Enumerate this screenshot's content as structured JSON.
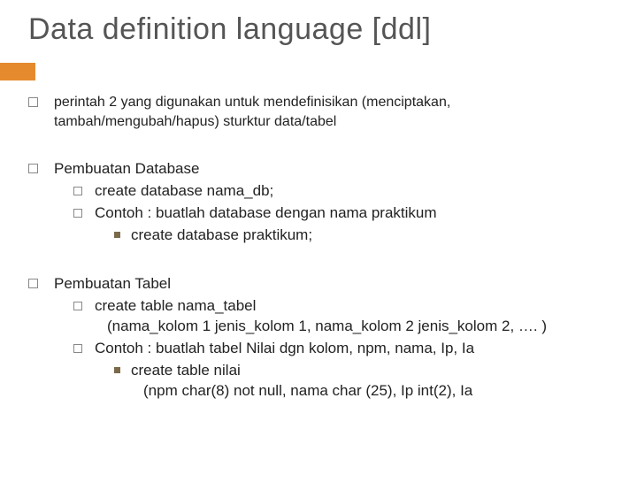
{
  "title": "Data definition language [ddl]",
  "items": [
    {
      "text": "perintah 2 yang digunakan untuk mendefinisikan (menciptakan, tambah/mengubah/hapus) sturktur data/tabel"
    },
    {
      "text": "Pembuatan Database",
      "children": [
        {
          "text": "create database nama_db;"
        },
        {
          "text": "Contoh : buatlah database dengan nama praktikum",
          "children": [
            {
              "text": "create database praktikum;"
            }
          ]
        }
      ]
    },
    {
      "text": "Pembuatan Tabel",
      "children": [
        {
          "text": "create table nama_tabel",
          "cont": "(nama_kolom 1 jenis_kolom 1, nama_kolom 2 jenis_kolom 2, …. )"
        },
        {
          "text": "Contoh : buatlah tabel Nilai dgn kolom, npm, nama, Ip, Ia",
          "children": [
            {
              "text": "create table nilai",
              "cont": "(npm char(8) not null, nama char (25), Ip int(2), Ia"
            }
          ]
        }
      ]
    }
  ]
}
